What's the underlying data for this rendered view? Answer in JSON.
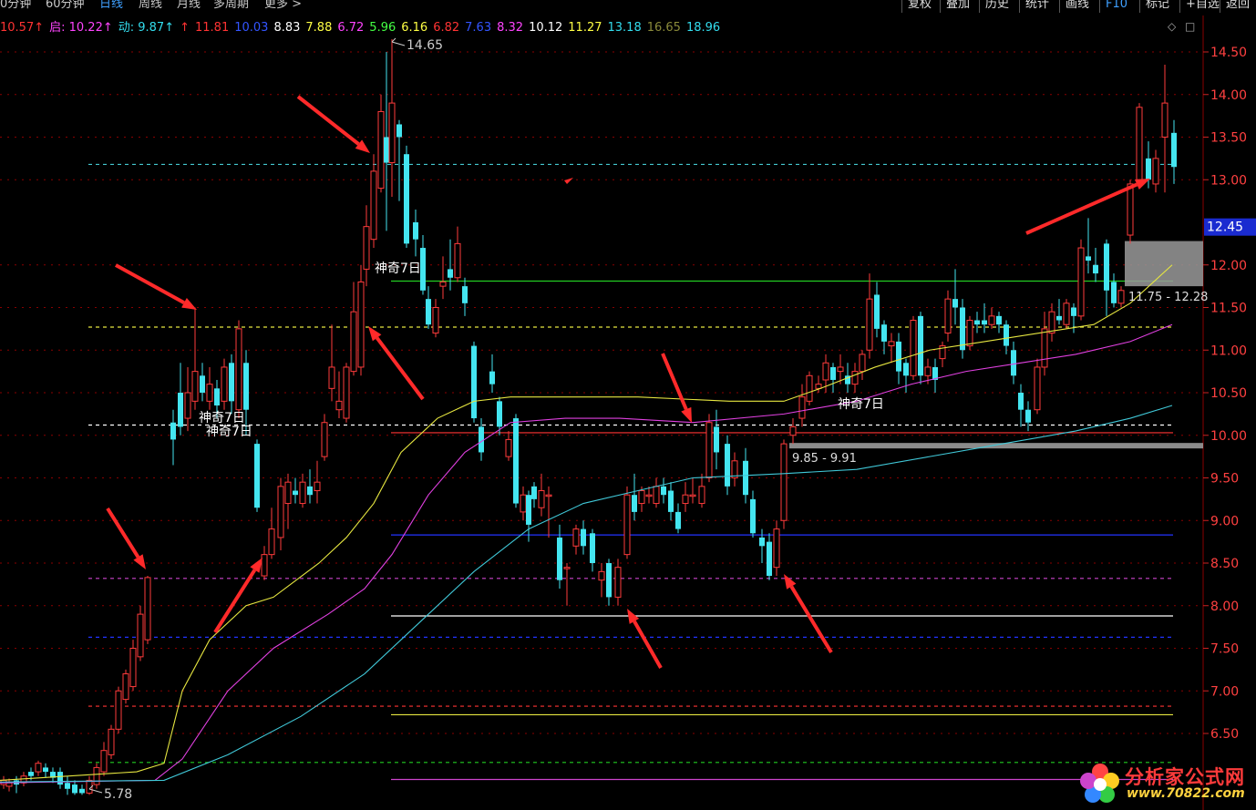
{
  "toolbar": {
    "periods": [
      {
        "label": "0分钟",
        "active": false
      },
      {
        "label": "60分钟",
        "active": false
      },
      {
        "label": "日线",
        "active": true
      },
      {
        "label": "周线",
        "active": false
      },
      {
        "label": "月线",
        "active": false
      },
      {
        "label": "多周期",
        "active": false
      },
      {
        "label": "更多 >",
        "active": false
      }
    ],
    "buttons": [
      "复权",
      "叠加",
      "历史",
      "统计",
      "画线",
      "F10",
      "标记",
      "+自选",
      "返回"
    ]
  },
  "indicators": {
    "items": [
      {
        "label": "10.57↑",
        "color": "#ff3333"
      },
      {
        "label": "启: 10.22↑",
        "color": "#ff44ff"
      },
      {
        "label": "动: 9.87↑",
        "color": "#33ddee"
      },
      {
        "label": "↑",
        "color": "#ff3333"
      },
      {
        "label": "11.81",
        "color": "#ff3333"
      },
      {
        "label": "10.03",
        "color": "#3355ff"
      },
      {
        "label": "8.83",
        "color": "#ffffff"
      },
      {
        "label": "7.88",
        "color": "#ffff44"
      },
      {
        "label": "6.72",
        "color": "#ff44ff"
      },
      {
        "label": "5.96",
        "color": "#44ff44"
      },
      {
        "label": "6.16",
        "color": "#ffff44"
      },
      {
        "label": "6.82",
        "color": "#ff3333"
      },
      {
        "label": "7.63",
        "color": "#3355ff"
      },
      {
        "label": "8.32",
        "color": "#ff44ff"
      },
      {
        "label": "10.12",
        "color": "#ffffff"
      },
      {
        "label": "11.27",
        "color": "#ffff44"
      },
      {
        "label": "13.18",
        "color": "#33ddee"
      },
      {
        "label": "16.65",
        "color": "#8a8a3a"
      },
      {
        "label": "18.96",
        "color": "#33ddee"
      }
    ]
  },
  "controls": {
    "diamond": "◇",
    "square": "□"
  },
  "price_axis": {
    "ticks": [
      14.5,
      14.0,
      13.5,
      13.0,
      12.0,
      11.5,
      11.0,
      10.5,
      10.0,
      9.5,
      9.0,
      8.5,
      8.0,
      7.5,
      7.0,
      6.5
    ],
    "current_price": "12.45"
  },
  "annotations": {
    "high_label": "14.65",
    "low_label": "5.78",
    "magic7": [
      "神奇7日",
      "神奇7日",
      "神奇7日",
      "神奇7日"
    ],
    "zone_upper": "11.75 - 12.28",
    "zone_lower": "9.85 - 9.91"
  },
  "watermark": {
    "name": "分析家公式网",
    "url": "www.70822.com"
  },
  "colors": {
    "up": "#ff3b3b",
    "down": "#44e5f0",
    "grid": "#8a0000",
    "ma_yellow": "#e6e640",
    "ma_magenta": "#e040e0",
    "ma_cyan": "#40c8d8"
  },
  "chart_data": {
    "type": "candlestick",
    "ylim": [
      5.5,
      14.8
    ],
    "hlines": [
      {
        "y": 13.18,
        "color": "#44c8d0",
        "style": "dashed"
      },
      {
        "y": 11.27,
        "color": "#e6e640",
        "style": "dashed"
      },
      {
        "y": 11.81,
        "color": "#22cc22",
        "style": "solid"
      },
      {
        "y": 10.12,
        "color": "#ffffff",
        "style": "dashed"
      },
      {
        "y": 10.03,
        "color": "#ff3333",
        "style": "solid"
      },
      {
        "y": 8.83,
        "color": "#2233ff",
        "style": "solid"
      },
      {
        "y": 8.32,
        "color": "#cc44cc",
        "style": "dashed"
      },
      {
        "y": 7.88,
        "color": "#ffffff",
        "style": "solid"
      },
      {
        "y": 7.63,
        "color": "#2233ff",
        "style": "dashed"
      },
      {
        "y": 6.82,
        "color": "#ff3333",
        "style": "dashed"
      },
      {
        "y": 6.72,
        "color": "#e6e640",
        "style": "solid"
      },
      {
        "y": 6.16,
        "color": "#22cc22",
        "style": "dashed"
      },
      {
        "y": 5.96,
        "color": "#cc44cc",
        "style": "solid"
      }
    ]
  }
}
